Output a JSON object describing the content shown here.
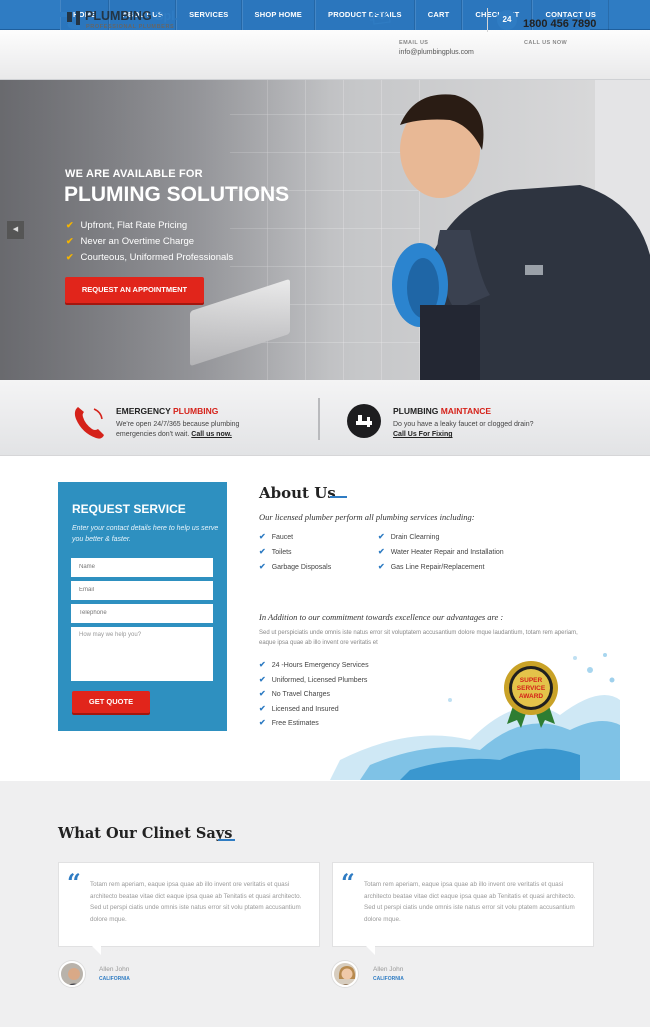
{
  "nav": {
    "items": [
      "HOME",
      "ABOUT US",
      "SERVICES",
      "SHOP HOME",
      "PRODUCT DETAILS",
      "CART",
      "CHECKOUT",
      "CONTACT US"
    ]
  },
  "header": {
    "logo_main": "PLUMBING",
    "logo_accent": "Spl.",
    "logo_sub": "PROFESSIONAL PLUMBERS",
    "email_label": "EMAIL US",
    "email_value": "info@plumbingplus.com",
    "call_label": "CALL US NOW",
    "call_icon_text": "24",
    "phone": "1800 456 7890"
  },
  "hero": {
    "small_heading": "WE ARE AVAILABLE FOR",
    "big_heading": "PLUMING SOLUTIONS",
    "bullets": [
      "Upfront, Flat Rate Pricing",
      "Never an Overtime Charge",
      "Courteous, Uniformed Professionals"
    ],
    "cta": "REQUEST AN APPOINTMENT",
    "slider_prev": "◀"
  },
  "features": {
    "emergency": {
      "title_a": "EMERGENCY ",
      "title_b": "PLUMBING",
      "line1": "We're open 24/7/365 because plumbing",
      "line2": "emergencies don't wait.",
      "link": "Call us now."
    },
    "maintance": {
      "title_a": "PLUMBING ",
      "title_b": "MAINTANCE",
      "line1": "Do you have a leaky faucet or clogged drain?",
      "link": "Call Us For Fixing"
    }
  },
  "request": {
    "title": "REQUEST SERVICE",
    "desc": "Enter your contact details here to help us serve you better & faster.",
    "name_ph": "Name",
    "email_ph": "Email",
    "phone_ph": "Telephone",
    "message_ph": "How may we help you?",
    "button": "GET QUOTE"
  },
  "about": {
    "title": "About Us",
    "intro": "Our licensed plumber perform all plumbing services including:",
    "services_left": [
      "Faucet",
      "Toilets",
      "Garbage Disposals"
    ],
    "services_right": [
      "Drain Clearning",
      "Water Heater Repair and Installation",
      "Gas Line Repair/Replacement"
    ],
    "intro2": "In Addition to our commitment towards excellence our advantages are :",
    "paragraph": "Sed ut perspiciatis unde omnis iste natus error sit voluptatem accusantium dolore mque laudantium, totam rem aperiam, eaque ipsa quae ab illo invent ore veritatis et",
    "advantages": [
      "24 -Hours Emergency Services",
      "Uniformed, Licensed Plumbers",
      "No Travel Charges",
      "Licensed and Insured",
      "Free Estimates"
    ],
    "award_line1": "SUPER",
    "award_line2": "SERVICE",
    "award_line3": "AWARD"
  },
  "testimonials": {
    "title": "What Our Clinet Says",
    "items": [
      {
        "text": "Totam rem aperiam, eaque ipsa quae ab illo invent ore veritatis et quasi architecto beatae vitae dict eaque ipsa quae ab Tenitatis et quasi architecto. Sed ut perspi ciatis unde omnis iste natus error sit volu ptatem accusantium dolore mque.",
        "author": "Allen John",
        "location": "CALIFORNIA"
      },
      {
        "text": "Totam rem aperiam, eaque ipsa quae ab illo invent ore veritatis et quasi architecto beatae vitae dict eaque ipsa quae ab Tenitatis et quasi architecto. Sed ut perspi ciatis unde omnis iste natus error sit volu ptatem accusantium dolore mque.",
        "author": "Allen John",
        "location": "CALIFORNIA"
      }
    ]
  },
  "colors": {
    "brand_blue": "#2f7cc3",
    "accent_red": "#e1251b",
    "form_blue": "#2e90c0"
  }
}
